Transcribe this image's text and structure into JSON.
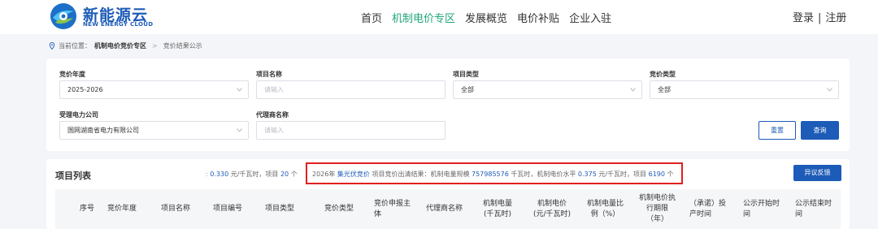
{
  "header": {
    "logo_cn": "新能源云",
    "logo_en": "NEW ENERGY CLOUD",
    "nav": [
      "首页",
      "机制电价专区",
      "发展概览",
      "电价补贴",
      "企业入驻"
    ],
    "nav_active_index": 1,
    "login": "登录",
    "auth_separator": "|",
    "register": "注册"
  },
  "breadcrumb": {
    "prefix": "当前位置：",
    "section": "机制电价竞价专区",
    "separator": ">",
    "current": "竞价结果公示"
  },
  "search": {
    "year_label": "竞价年度",
    "year_value": "2025-2026",
    "name_label": "项目名称",
    "name_placeholder": "请输入",
    "type_label": "项目类型",
    "type_value": "全部",
    "bid_type_label": "竞价类型",
    "bid_type_value": "全部",
    "company_label": "受理电力公司",
    "company_value": "国网湖南省电力有限公司",
    "agent_label": "代理商名称",
    "agent_placeholder": "请输入",
    "reset_label": "重置",
    "query_label": "查询"
  },
  "list": {
    "title": "项目列表",
    "partial_summary": {
      "price": "0.330",
      "price_unit": "元/千瓦时，项目",
      "count": "20",
      "count_unit": "个"
    },
    "summary": {
      "year": "2026年",
      "category": "集光伏竞价",
      "text1": "项目竞价出清结果：机制电量规模",
      "volume": "757985576",
      "text2": "千瓦时，机制电价水平",
      "price": "0.375",
      "text3": "元/千瓦时，项目",
      "count": "6190",
      "text4": "个"
    },
    "objection_label": "异议反馈",
    "columns": [
      "序号",
      "竞价年度",
      "项目名称",
      "项目编号",
      "项目类型",
      "竞价类型",
      "竞价申报主体",
      "代理商名称",
      "机制电量(千瓦时)",
      "机制电价(元/千瓦时)",
      "机制电量比例（%）",
      "机制电价执行期限（年）",
      "（承诺）投产时间",
      "公示开始时间",
      "公示结束时间"
    ],
    "columns_display": [
      [
        "序号"
      ],
      [
        "竞价年度"
      ],
      [
        "项目名称"
      ],
      [
        "项目编号"
      ],
      [
        "项目类型"
      ],
      [
        "竞价类型"
      ],
      [
        "竞价申报主",
        "体"
      ],
      [
        "代理商名称"
      ],
      [
        "机制电量",
        "(千瓦时)"
      ],
      [
        "机制电价",
        "(元/千瓦时)"
      ],
      [
        "机制电量比",
        "例（%）"
      ],
      [
        "机制电价执",
        "行期限",
        "（年）"
      ],
      [
        "（承诺）投",
        "产时间"
      ],
      [
        "公示开始时",
        "间"
      ],
      [
        "公示结束时",
        "间"
      ]
    ]
  },
  "colors": {
    "brand_blue": "#1d5bb8",
    "nav_active_green": "#21a47a",
    "highlight_red": "#e02020"
  },
  "icons": [
    "logo-mark",
    "location-pin-icon",
    "chevron-right-icon",
    "chevron-down-icon"
  ]
}
